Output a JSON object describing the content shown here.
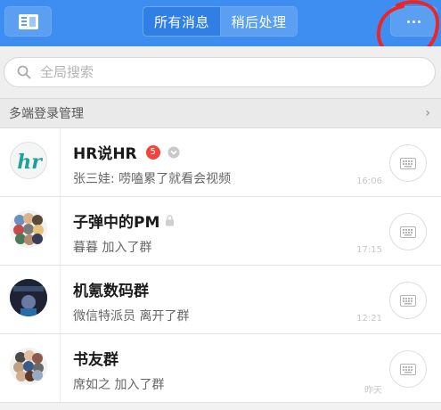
{
  "header": {
    "contacts_icon": "contacts-card-icon",
    "tabs": [
      {
        "label": "所有消息",
        "active": true
      },
      {
        "label": "稍后处理",
        "active": false
      }
    ],
    "more_icon": "more-dots-icon",
    "colors": {
      "bar": "#3e8ef1",
      "active_tab": "#2f7fe4",
      "annotation": "#e8262b"
    }
  },
  "search": {
    "placeholder": "全局搜索",
    "icon": "search-icon"
  },
  "multi_login": {
    "label": "多端登录管理",
    "icon": "chevron-right-icon"
  },
  "conversations": [
    {
      "name": "HR说HR",
      "badge": "5",
      "muted": true,
      "preview": "张三娃: 唠嗑累了就看会视频",
      "time": "16:06",
      "avatar": "hr-logo"
    },
    {
      "name": "子弹中的PM",
      "locked": true,
      "preview": "暮暮 加入了群",
      "time": "17:15",
      "avatar": "group-grid"
    },
    {
      "name": "机氪数码群",
      "preview": "微信特派员 离开了群",
      "time": "12:21",
      "avatar": "photo-dark"
    },
    {
      "name": "书友群",
      "preview": "席如之 加入了群",
      "time": "昨天",
      "avatar": "group-grid"
    }
  ]
}
